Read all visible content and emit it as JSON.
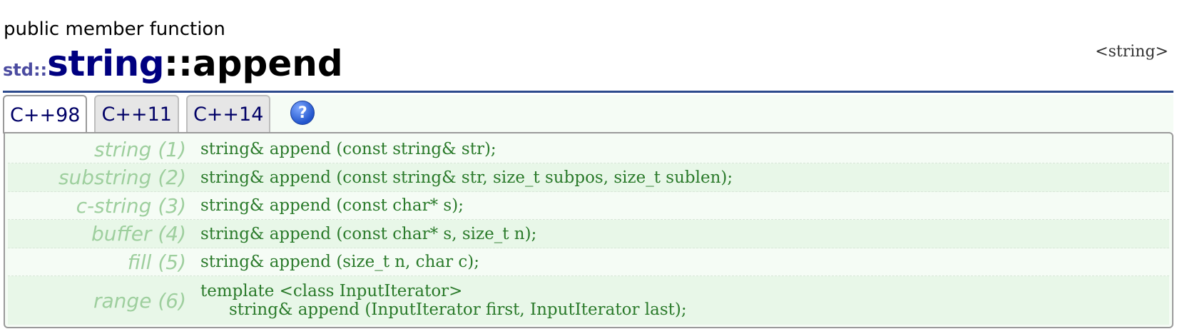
{
  "page": {
    "kind": "public member function",
    "namespace": "std::",
    "class_name": "string",
    "separator": "::",
    "function_name": "append",
    "header": "<string>"
  },
  "tabs": [
    {
      "label": "C++98",
      "active": true
    },
    {
      "label": "C++11",
      "active": false
    },
    {
      "label": "C++14",
      "active": false
    }
  ],
  "help_icon": {
    "glyph": "?",
    "icon": "help-icon"
  },
  "overloads": [
    {
      "label": "string (1)",
      "lines": [
        "string& append (const string& str);"
      ]
    },
    {
      "label": "substring (2)",
      "lines": [
        "string& append (const string& str, size_t subpos, size_t sublen);"
      ]
    },
    {
      "label": "c-string (3)",
      "lines": [
        "string& append (const char* s);"
      ]
    },
    {
      "label": "buffer (4)",
      "lines": [
        "string& append (const char* s, size_t n);"
      ]
    },
    {
      "label": "fill (5)",
      "lines": [
        "string& append (size_t n, char c);"
      ]
    },
    {
      "label": "range (6)",
      "lines": [
        "template <class InputIterator>",
        "string& append (InputIterator first, InputIterator last);"
      ]
    }
  ],
  "colors": {
    "accent_rule": "#2c4a8c",
    "class_name": "#000080",
    "code_text": "#2a7a2a",
    "label_text": "#9ecf9e",
    "panel_bg": "#f5fcf5"
  }
}
